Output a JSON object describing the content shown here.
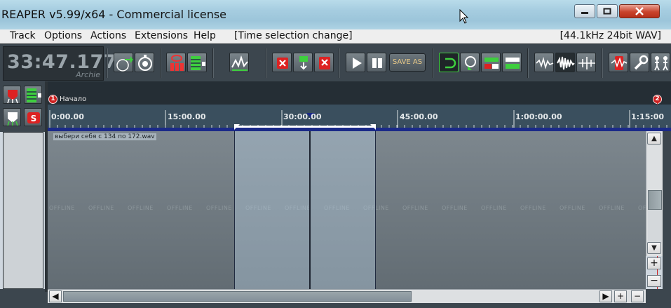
{
  "window": {
    "title": "REAPER v5.99/x64 - Commercial license",
    "controls": {
      "minimize": "—",
      "maximize": "□",
      "close": "✕"
    }
  },
  "menu": {
    "items": [
      "Track",
      "Options",
      "Actions",
      "Extensions",
      "Help"
    ],
    "status": "[Time selection change]",
    "format": "[44.1kHz 24bit WAV]"
  },
  "transport": {
    "time": "33:47.177",
    "user": "Archie",
    "save_as_label": "SAVE AS"
  },
  "toolbar_icons": [
    "metronome-icon",
    "tempo-icon",
    "mixer-icon",
    "track-manager-icon",
    "envelope-icon",
    "delete-icon",
    "record-input-icon",
    "remove-items-icon",
    "play-icon",
    "stop-icon",
    "loop-icon",
    "repeat-icon",
    "snap-icon",
    "grid-icon",
    "waveform-icon",
    "waveform-peaks-icon",
    "spectral-icon",
    "fx-icon",
    "wrench-icon",
    "routing-icon"
  ],
  "markers": [
    {
      "number": "1",
      "label": "Начало"
    },
    {
      "number": "2",
      "label": ""
    }
  ],
  "ruler": {
    "labels": [
      "0:00.00",
      "15:00.00",
      "30:00.00",
      "45:00.00",
      "1:00:00.00",
      "1:15:00"
    ]
  },
  "item": {
    "name": "выбери себя с 134 по 172.wav",
    "offline_text": "OFFLINE"
  },
  "scroll": {
    "up": "▲",
    "down": "▼",
    "left": "◀",
    "right": "▶",
    "zoom_in": "+",
    "zoom_out": "−"
  },
  "colors": {
    "toolbar_bg": "#3c464e",
    "ruler_bg": "#3a4f5e",
    "time_selection": "#b4cde1",
    "marker_red": "#cc2020"
  }
}
